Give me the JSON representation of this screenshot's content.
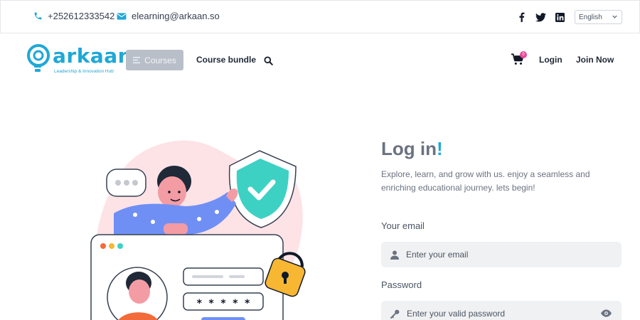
{
  "topbar": {
    "phone": "+252612333542",
    "email": "elearning@arkaan.so",
    "socials": [
      "facebook-icon",
      "twitter-icon",
      "linkedin-icon"
    ],
    "language": "English"
  },
  "nav": {
    "logo_word": "arkaan",
    "logo_tagline": "Leadership & Innovation Hub",
    "courses_label": "Courses",
    "bundle_label": "Course bundle",
    "cart_count": "0",
    "login_label": "Login",
    "join_label": "Join Now"
  },
  "form": {
    "title": "Log in",
    "title_mark": "!",
    "description": "Explore, learn, and grow with us. enjoy a seamless and enriching educational journey. lets begin!",
    "email_label": "Your email",
    "email_placeholder": "Enter your email",
    "password_label": "Password",
    "password_placeholder": "Enter your valid password"
  },
  "illustration": {
    "password_mask": "* * * * *"
  },
  "colors": {
    "accent": "#1fa8d6",
    "shield": "#3dd1c4",
    "badge": "#ec4899",
    "lock": "#f7b733",
    "person_shirt": "#6f8ff5"
  }
}
